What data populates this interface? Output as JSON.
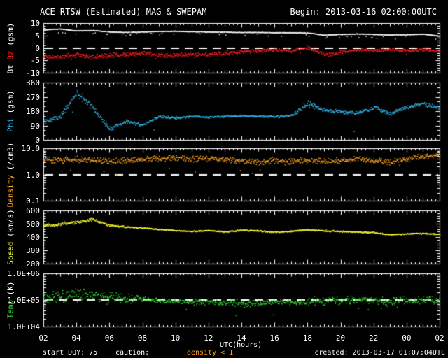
{
  "header": {
    "title": "ACE RTSW (Estimated) MAG & SWEPAM",
    "begin": "Begin: 2013-03-16 02:00:00UTC"
  },
  "footer": {
    "start_doy": "start DOY: 75",
    "caution_label": "caution:",
    "density_caution": "density < 1",
    "density_caution_color": "#ffa520",
    "created": "created: 2013-03-17 01:07:04UTC"
  },
  "xaxis": {
    "title": "UTC(hours)",
    "tick_labels": [
      "02",
      "04",
      "06",
      "08",
      "10",
      "12",
      "14",
      "16",
      "18",
      "20",
      "22",
      "00",
      "02"
    ],
    "range_hours": [
      2,
      26
    ]
  },
  "colors": {
    "background": "#000000",
    "axis": "#ffffff",
    "refline": "#ffffff"
  },
  "chart_data": {
    "type": "scatter",
    "xlabel": "UTC(hours)",
    "x_hours": [
      2,
      3,
      4,
      5,
      6,
      7,
      8,
      9,
      10,
      11,
      12,
      13,
      14,
      15,
      16,
      17,
      18,
      19,
      20,
      21,
      22,
      23,
      24,
      25,
      26
    ],
    "panels": [
      {
        "key": "bt-bz",
        "scale": "linear",
        "ylim": [
          -10,
          10
        ],
        "yminor": 1,
        "refline": 0,
        "yticks": [
          {
            "v": 10,
            "label": "10"
          },
          {
            "v": 5,
            "label": "5"
          },
          {
            "v": 0,
            "label": "0"
          },
          {
            "v": -5,
            "label": "-5"
          },
          {
            "v": -10,
            "label": "-10"
          }
        ],
        "label_parts": [
          {
            "text": "Bt ",
            "color": "#ffffff"
          },
          {
            "text": "Bz",
            "color": "#ff2020"
          },
          {
            "text": " (gsm)",
            "color": "#ffffff"
          }
        ],
        "series": [
          {
            "name": "Bt",
            "color": "#ffffff",
            "style": "dots",
            "values": [
              7.4,
              7.8,
              7.0,
              7.2,
              6.6,
              6.4,
              6.6,
              6.8,
              6.9,
              6.7,
              6.6,
              6.5,
              6.4,
              6.4,
              6.3,
              6.3,
              6.2,
              5.3,
              5.6,
              5.8,
              5.6,
              5.4,
              5.5,
              5.7,
              4.9
            ],
            "spread": 0.15,
            "outliers": {
              "rate": 0.03,
              "mag": -1.5
            }
          },
          {
            "name": "Bz",
            "color": "#ff2020",
            "style": "dots",
            "values": [
              -3.2,
              -3.6,
              -2.6,
              -3.4,
              -3.0,
              -2.4,
              -2.0,
              -2.6,
              -3.0,
              -2.2,
              -2.6,
              -2.0,
              -1.4,
              -1.0,
              -0.6,
              -1.0,
              0.3,
              -2.6,
              -1.6,
              -0.6,
              -1.0,
              -0.5,
              -1.0,
              -0.5,
              -1.2
            ],
            "spread": [
              1.2,
              1.2,
              1.3,
              1.2,
              1.2,
              1.1,
              1.0,
              1.1,
              1.2,
              1.0,
              1.1,
              1.0,
              0.9,
              0.8,
              0.8,
              0.9,
              0.8,
              1.0,
              0.9,
              0.7,
              0.8,
              0.7,
              0.8,
              0.7,
              0.8
            ],
            "outliers": {
              "rate": 0.01,
              "mag": -1.5
            }
          }
        ]
      },
      {
        "key": "phi",
        "scale": "linear",
        "ylim": [
          0,
          360
        ],
        "yminor": 30,
        "refline": null,
        "yticks": [
          {
            "v": 360,
            "label": "360"
          },
          {
            "v": 270,
            "label": "270"
          },
          {
            "v": 180,
            "label": "180"
          },
          {
            "v": 90,
            "label": "90"
          },
          {
            "v": 0,
            "label": "0"
          }
        ],
        "label_parts": [
          {
            "text": "Phi ",
            "color": "#33bbee"
          },
          {
            "text": "(gsm)",
            "color": "#ffffff"
          }
        ],
        "series": [
          {
            "name": "Phi",
            "color": "#33bbee",
            "style": "dots",
            "values": [
              115,
              150,
              300,
              200,
              70,
              120,
              95,
              150,
              140,
              150,
              145,
              150,
              152,
              150,
              148,
              155,
              230,
              190,
              180,
              170,
              205,
              165,
              210,
              225,
              200
            ],
            "spread": [
              15,
              25,
              30,
              25,
              20,
              15,
              12,
              10,
              10,
              8,
              8,
              8,
              8,
              8,
              8,
              10,
              25,
              15,
              15,
              12,
              18,
              15,
              15,
              18,
              15
            ],
            "outliers": {
              "rate": 0.004,
              "mag": -120
            }
          }
        ]
      },
      {
        "key": "density",
        "scale": "log",
        "ylim": [
          0.1,
          10
        ],
        "refline": 1.0,
        "yticks": [
          {
            "v": 10,
            "label": "10.0"
          },
          {
            "v": 1,
            "label": "1.0"
          },
          {
            "v": 0.1,
            "label": "0.1"
          }
        ],
        "label_parts": [
          {
            "text": "Density ",
            "color": "#ffa520"
          },
          {
            "text": "(/cm3)",
            "color": "#ffffff"
          }
        ],
        "series": [
          {
            "name": "Density",
            "color": "#ffa520",
            "style": "dots",
            "values": [
              4.0,
              3.5,
              4.0,
              3.5,
              3.2,
              3.5,
              4.0,
              4.2,
              4.5,
              4.0,
              4.2,
              4.0,
              3.5,
              3.2,
              3.5,
              3.2,
              3.5,
              3.2,
              3.5,
              4.0,
              3.5,
              3.2,
              4.0,
              5.2,
              5.6
            ],
            "spread": 0.14,
            "outliers": {
              "rate": 0.015,
              "mag": -0.6
            }
          }
        ]
      },
      {
        "key": "speed",
        "scale": "linear",
        "ylim": [
          200,
          600
        ],
        "yminor": 20,
        "refline": null,
        "yticks": [
          {
            "v": 600,
            "label": "600"
          },
          {
            "v": 500,
            "label": "500"
          },
          {
            "v": 400,
            "label": "400"
          },
          {
            "v": 300,
            "label": "300"
          },
          {
            "v": 200,
            "label": "200"
          }
        ],
        "label_parts": [
          {
            "text": "Speed ",
            "color": "#ffff33"
          },
          {
            "text": "(km/s)",
            "color": "#ffffff"
          }
        ],
        "series": [
          {
            "name": "Speed",
            "color": "#ffff33",
            "style": "dots",
            "values": [
              490,
              500,
              515,
              535,
              490,
              478,
              470,
              462,
              452,
              446,
              452,
              442,
              455,
              450,
              440,
              446,
              458,
              450,
              446,
              440,
              436,
              420,
              426,
              430,
              424
            ],
            "spread": [
              14,
              14,
              16,
              14,
              10,
              8,
              7,
              6,
              6,
              6,
              6,
              6,
              7,
              7,
              6,
              6,
              8,
              8,
              7,
              6,
              6,
              6,
              6,
              6,
              6
            ]
          }
        ]
      },
      {
        "key": "temp",
        "scale": "log",
        "ylim": [
          10000,
          1000000
        ],
        "refline": 100000,
        "yticks": [
          {
            "v": 1000000,
            "label": "1.0E+06"
          },
          {
            "v": 100000,
            "label": "1.0E+05"
          },
          {
            "v": 10000,
            "label": "1.0E+04"
          }
        ],
        "label_parts": [
          {
            "text": "Temp ",
            "color": "#33dd33"
          },
          {
            "text": "(K)",
            "color": "#ffffff"
          }
        ],
        "series": [
          {
            "name": "Temp",
            "color": "#33dd33",
            "style": "dots",
            "values": [
              130000,
              140000,
              160000,
              150000,
              130000,
              120000,
              110000,
              100000,
              90000,
              85000,
              90000,
              80000,
              75000,
              80000,
              90000,
              85000,
              90000,
              100000,
              95000,
              110000,
              100000,
              90000,
              100000,
              110000,
              100000
            ],
            "spread": [
              0.28,
              0.28,
              0.3,
              0.28,
              0.25,
              0.22,
              0.14,
              0.1,
              0.1,
              0.12,
              0.15,
              0.15,
              0.18,
              0.15,
              0.12,
              0.15,
              0.18,
              0.2,
              0.18,
              0.18,
              0.18,
              0.2,
              0.18,
              0.18,
              0.18
            ],
            "outliers": {
              "rate": 0.01,
              "mag": -0.45
            }
          }
        ]
      }
    ]
  }
}
